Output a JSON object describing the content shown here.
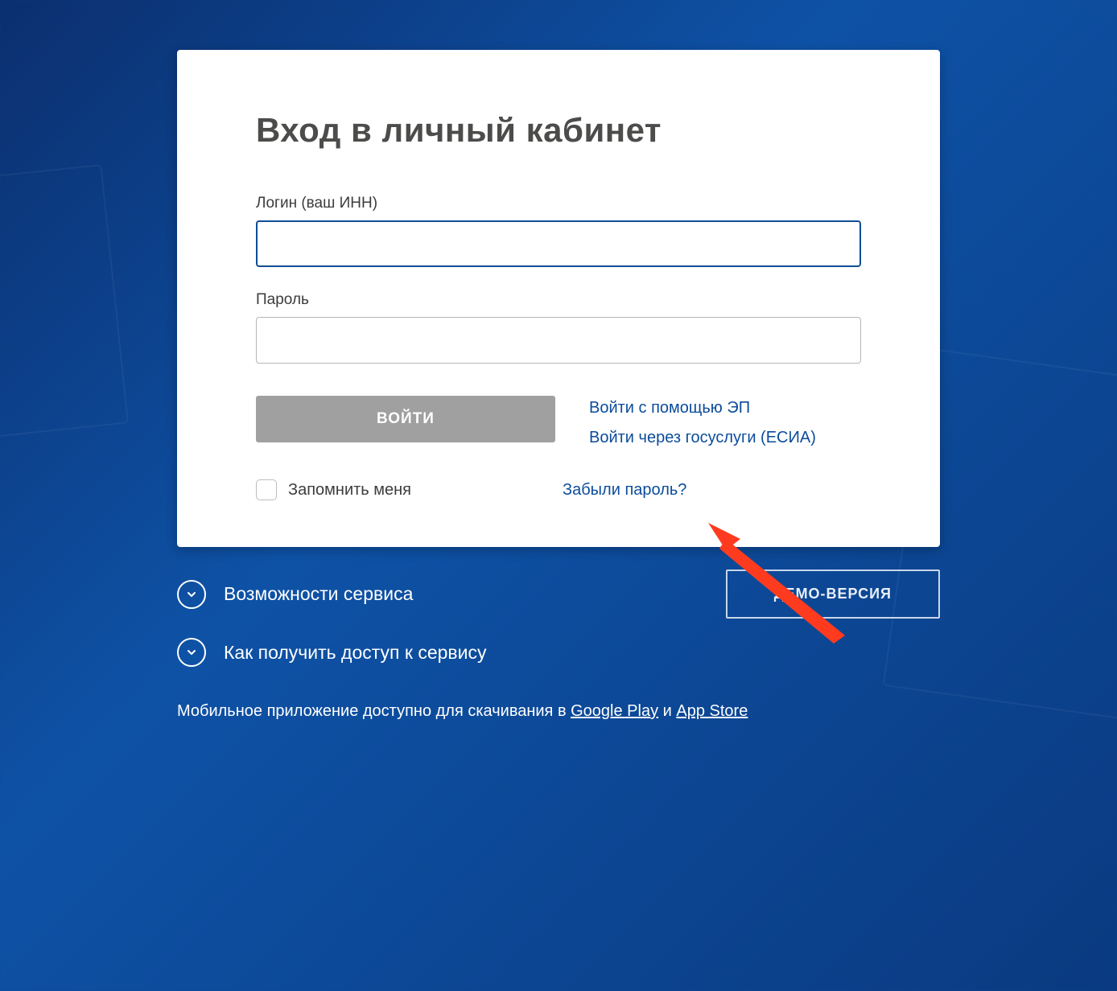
{
  "card": {
    "title": "Вход в личный кабинет",
    "login_label": "Логин (ваш ИНН)",
    "login_value": "",
    "password_label": "Пароль",
    "password_value": "",
    "submit_label": "ВОЙТИ",
    "alt_links": {
      "ep": "Войти с помощью ЭП",
      "esia": "Войти через госуслуги (ЕСИА)"
    },
    "remember_label": "Запомнить меня",
    "forgot_label": "Забыли пароль?"
  },
  "below": {
    "features_label": "Возможности сервиса",
    "access_label": "Как получить доступ к сервису",
    "demo_label": "ДЕМО-ВЕРСИЯ"
  },
  "mobile": {
    "prefix": "Мобильное приложение доступно для скачивания в ",
    "gp": "Google Play",
    "sep": " и ",
    "as": "App Store"
  }
}
